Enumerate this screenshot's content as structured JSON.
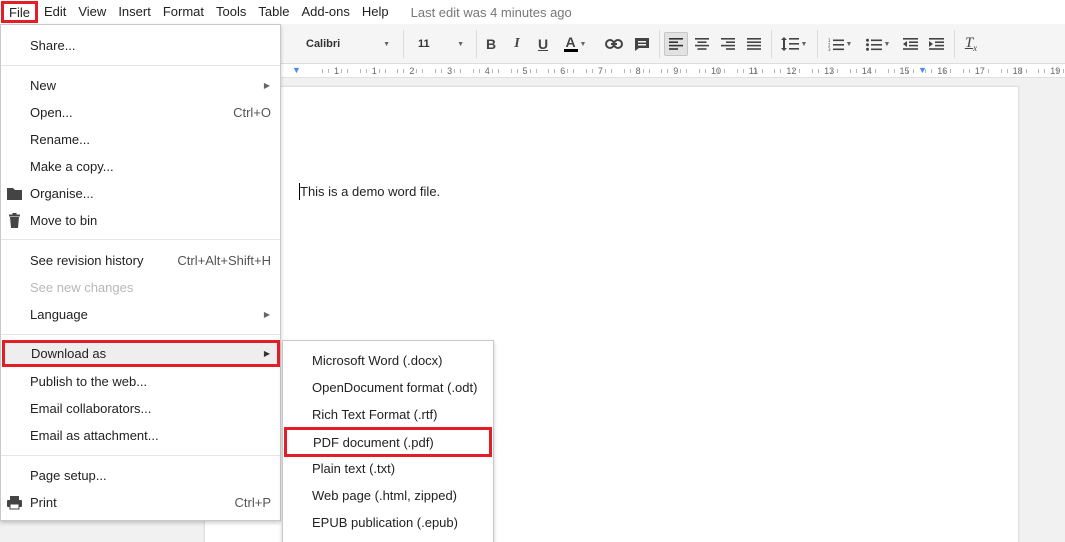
{
  "menubar": {
    "items": [
      "File",
      "Edit",
      "View",
      "Insert",
      "Format",
      "Tools",
      "Table",
      "Add-ons",
      "Help"
    ],
    "last_edit": "Last edit was 4 minutes ago"
  },
  "toolbar": {
    "font_family": "Calibri",
    "font_size": "11",
    "bold": "B",
    "italic": "I",
    "underline": "U",
    "text_color": "A",
    "clear_format": "Tx"
  },
  "ruler": {
    "ticks": [
      "1",
      "1",
      "2",
      "3",
      "4",
      "5",
      "6",
      "7",
      "8",
      "9",
      "10",
      "11",
      "12",
      "13",
      "14",
      "15",
      "16",
      "17",
      "18",
      "19"
    ]
  },
  "document": {
    "body_text": "This is a demo word file."
  },
  "file_menu": {
    "share": "Share...",
    "new": "New",
    "open": "Open...",
    "open_shortcut": "Ctrl+O",
    "rename": "Rename...",
    "make_copy": "Make a copy...",
    "organise": "Organise...",
    "move_to_bin": "Move to bin",
    "revision_history": "See revision history",
    "revision_shortcut": "Ctrl+Alt+Shift+H",
    "new_changes": "See new changes",
    "language": "Language",
    "download_as": "Download as",
    "publish": "Publish to the web...",
    "email_collaborators": "Email collaborators...",
    "email_attachment": "Email as attachment...",
    "page_setup": "Page setup...",
    "print": "Print",
    "print_shortcut": "Ctrl+P"
  },
  "download_menu": {
    "items": [
      "Microsoft Word (.docx)",
      "OpenDocument format (.odt)",
      "Rich Text Format (.rtf)",
      "PDF document (.pdf)",
      "Plain text (.txt)",
      "Web page (.html, zipped)",
      "EPUB publication (.epub)"
    ]
  },
  "colors": {
    "highlight_border": "#e41e26",
    "ruler_marker": "#4a8af4"
  }
}
